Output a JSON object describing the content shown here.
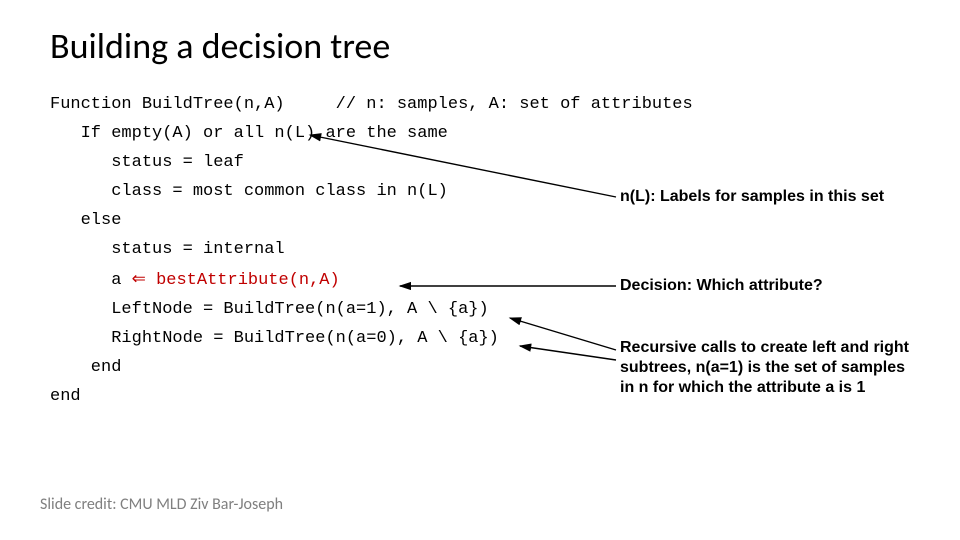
{
  "title": "Building a decision tree",
  "code": {
    "l1a": "Function BuildTree(n,A)",
    "l1b": "     // n: samples, A: set of attributes",
    "l2": "   If empty(A) or all n(L) are the same",
    "l3": "      status = leaf",
    "l4": "      class = most common class in n(L)",
    "l5": "   else",
    "l6": "      status = internal",
    "l7a": "      a ",
    "l7arrow": "⇐",
    "l7b": " bestAttribute(n,A)",
    "l8": "      LeftNode = BuildTree(n(a=1), A \\ {a})",
    "l9": "      RightNode = BuildTree(n(a=0), A \\ {a})",
    "l10": "    end",
    "l11": "end"
  },
  "annotations": {
    "a1": "n(L): Labels for samples in this set",
    "a2": "Decision: Which attribute?",
    "a3": "Recursive calls to create left and right subtrees, n(a=1) is the set of samples in n for which the attribute a is 1"
  },
  "credit": "Slide credit: CMU MLD Ziv Bar-Joseph"
}
